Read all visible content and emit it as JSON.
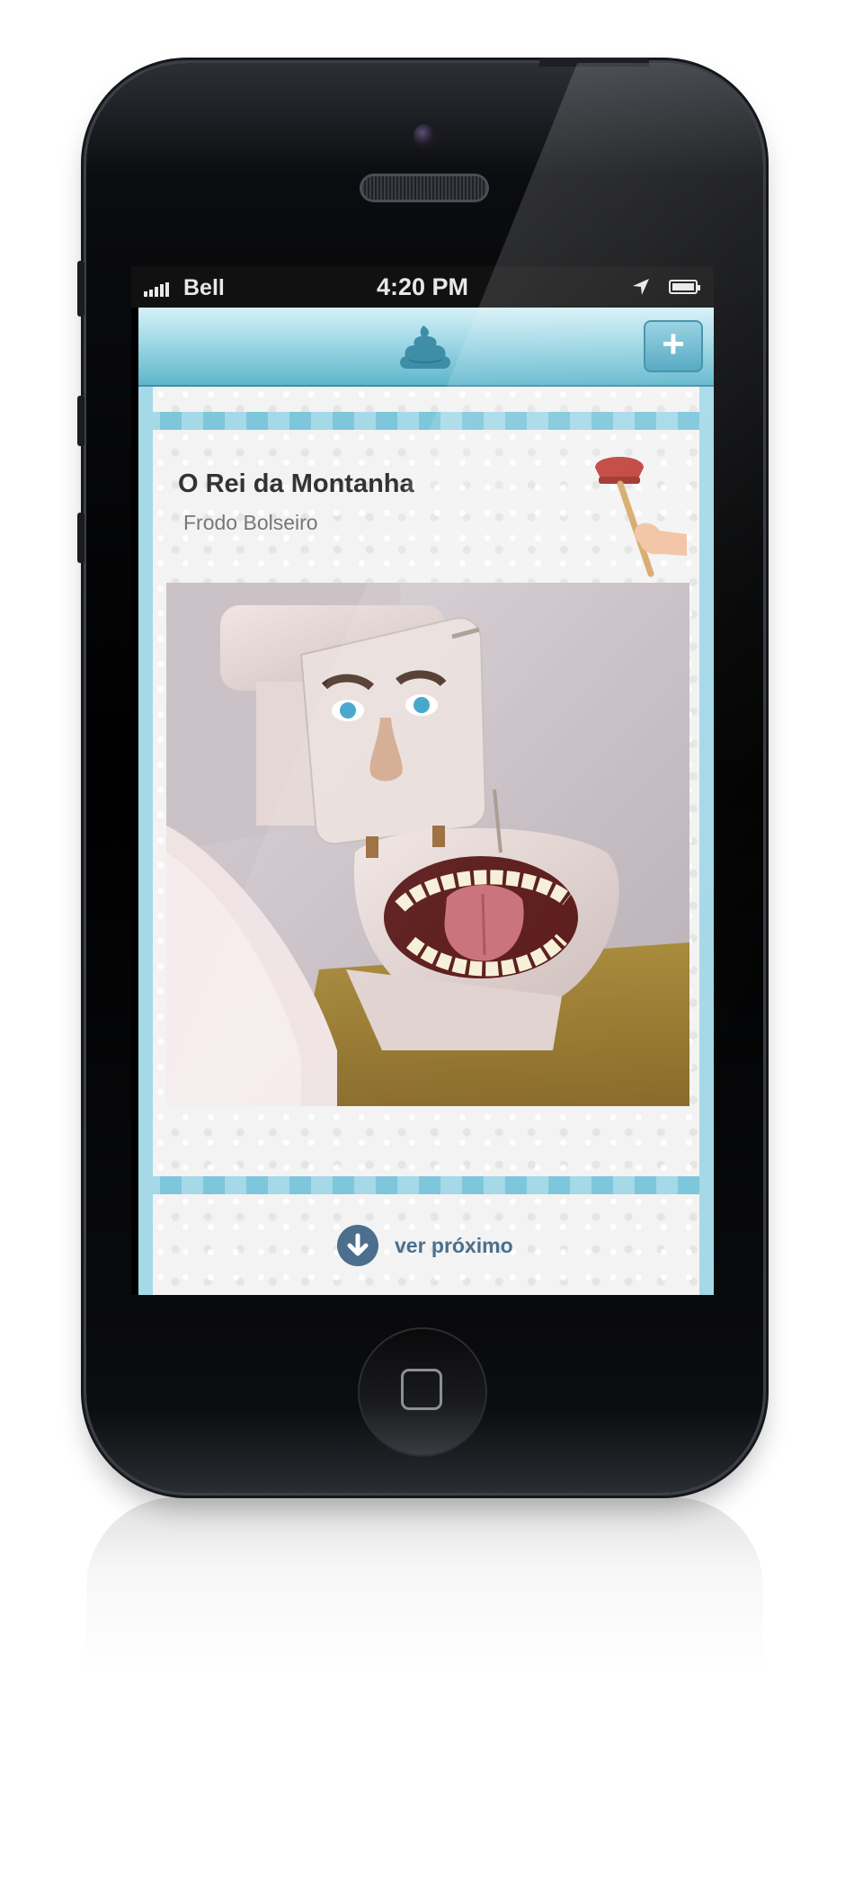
{
  "status_bar": {
    "carrier": "Bell",
    "time": "4:20 PM",
    "signal_icon": "signal-bars-icon",
    "location_icon": "location-arrow-icon",
    "battery_icon": "battery-icon"
  },
  "navbar": {
    "logo_icon": "poop-icon",
    "add_label": "+"
  },
  "post": {
    "title": "O Rei da Montanha",
    "author": "Frodo Bolseiro",
    "decoration_icon": "plunger-hand-icon",
    "image_description_icon": "toilet-face-photo"
  },
  "footer": {
    "next_label": "ver próximo",
    "next_icon": "arrow-down-circle-icon"
  },
  "colors": {
    "accent": "#5fb6cc",
    "stripe_light": "#a5d9e8",
    "stripe_dark": "#7ec6db",
    "next_button": "#4b6f8c",
    "title": "#333333"
  }
}
